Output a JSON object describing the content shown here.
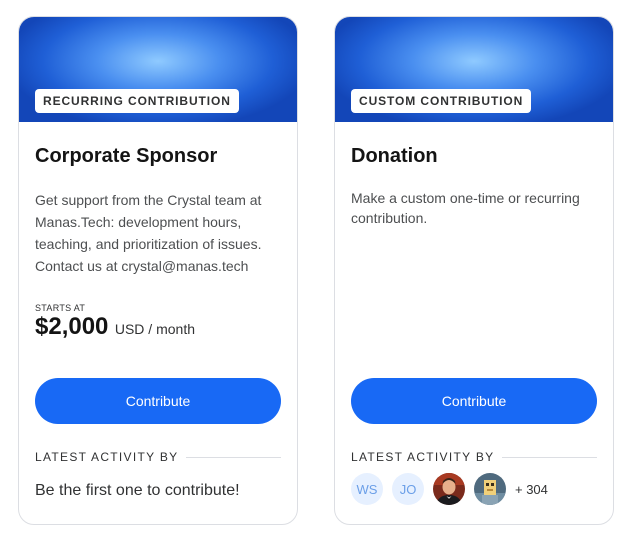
{
  "tiers": [
    {
      "tag": "RECURRING CONTRIBUTION",
      "title": "Corporate Sponsor",
      "description": "Get support from the Crystal team at Manas.Tech: development hours, teaching, and prioritization of issues. Contact us at crystal@manas.tech",
      "starts_at_label": "STARTS AT",
      "price_amount": "$2,000",
      "price_unit": "USD / month",
      "button_label": "Contribute",
      "activity_label": "LATEST ACTIVITY BY",
      "empty_activity": "Be the first one to contribute!"
    },
    {
      "tag": "CUSTOM CONTRIBUTION",
      "title": "Donation",
      "description": "Make a custom one-time or recurring contribution.",
      "button_label": "Contribute",
      "activity_label": "LATEST ACTIVITY BY",
      "contributors": [
        {
          "type": "initials",
          "text": "WS"
        },
        {
          "type": "initials",
          "text": "JO"
        },
        {
          "type": "photo",
          "icon": "person-photo-icon"
        },
        {
          "type": "photo",
          "icon": "pixel-avatar-icon"
        }
      ],
      "more_count": "+ 304"
    }
  ],
  "colors": {
    "primary": "#1869f5",
    "banner_light": "#8fcaff",
    "banner_dark": "#1346b8",
    "initials_bg": "#e6f0ff",
    "initials_text": "#6b9fe8"
  }
}
